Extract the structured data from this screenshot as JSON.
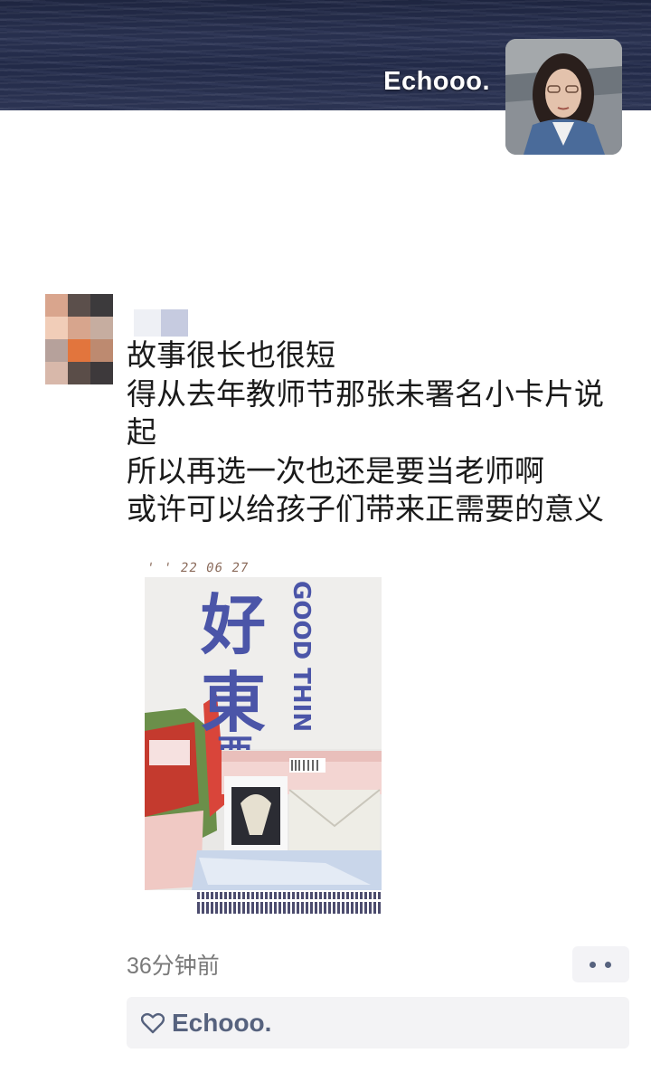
{
  "cover": {
    "display_name": "Echooo."
  },
  "post": {
    "lines": [
      "故事很长也很短",
      "得从去年教师节那张未署名小卡片说",
      "起",
      "所以再选一次也还是要当老师啊",
      "或许可以给孩子们带来正需要的意义"
    ],
    "photo": {
      "date_stamp": "' ' 22 06 27",
      "bag_text_cn": [
        "好",
        "東",
        "西"
      ],
      "bag_text_en": "GOOD THIN"
    },
    "timestamp": "36分钟前",
    "likes": {
      "names": "Echooo."
    }
  },
  "icons": {
    "more": "more-dots-icon",
    "like": "heart-outline-icon"
  },
  "colors": {
    "link_blue": "#56627e",
    "muted_text": "#7a7a7a",
    "likes_bg": "#f3f3f5"
  }
}
